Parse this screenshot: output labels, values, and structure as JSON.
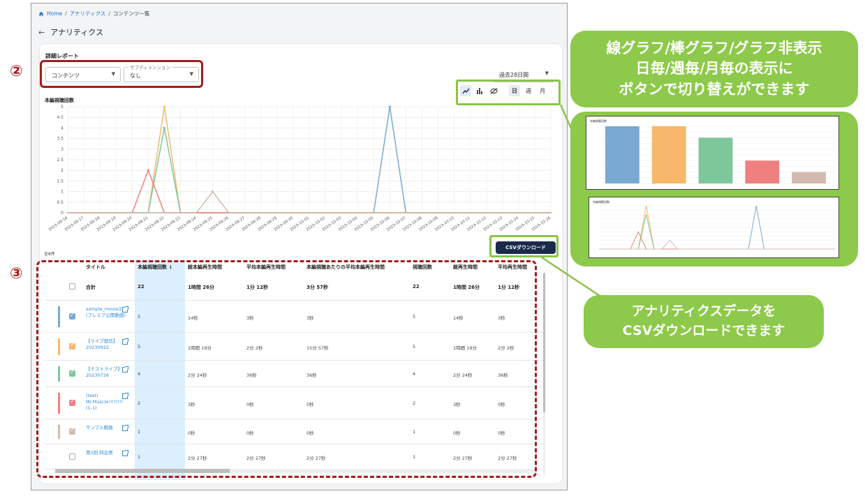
{
  "breadcrumb": {
    "home": "Home",
    "items": [
      "アナリティクス",
      "コンテンツ一覧"
    ]
  },
  "page": {
    "title": "アナリティクス"
  },
  "report": {
    "title": "詳細レポート",
    "dimension_select": "コンテンツ",
    "sub_dimension_label": "サブディメンション",
    "sub_dimension_value": "なし",
    "period_select": "過去28日間"
  },
  "chart_toolbar": {
    "day": "日",
    "week": "週",
    "month": "月",
    "icons": [
      "line-chart-icon",
      "bar-chart-icon",
      "hide-chart-icon"
    ]
  },
  "chart_data": {
    "type": "line",
    "title": "本編視聴回数",
    "ylim": [
      0,
      5
    ],
    "yticks": [
      "0",
      "0.5",
      "1",
      "1.5",
      "2",
      "2.5",
      "3",
      "3.5",
      "4",
      "4.5",
      "5"
    ],
    "x": [
      "2023-09-16",
      "2023-09-17",
      "2023-09-18",
      "2023-09-19",
      "2023-09-20",
      "2023-09-21",
      "2023-09-22",
      "2023-09-23",
      "2023-09-24",
      "2023-09-25",
      "2023-09-26",
      "2023-09-27",
      "2023-09-28",
      "2023-09-29",
      "2023-09-30",
      "2023-10-01",
      "2023-10-02",
      "2023-10-03",
      "2023-10-04",
      "2023-10-05",
      "2023-10-06",
      "2023-10-07",
      "2023-10-08",
      "2023-10-09",
      "2023-10-10",
      "2023-10-11",
      "2023-10-12",
      "2023-10-13",
      "2023-10-14",
      "2023-10-15",
      "2023-10-16"
    ],
    "series": [
      {
        "color": "#7aa9d1",
        "values": [
          0,
          0,
          0,
          0,
          0,
          0,
          0,
          0,
          0,
          0,
          0,
          0,
          0,
          0,
          0,
          0,
          0,
          0,
          0,
          0,
          5,
          0,
          0,
          0,
          0,
          0,
          0,
          0,
          0,
          0,
          0
        ]
      },
      {
        "color": "#f7b86b",
        "values": [
          0,
          0,
          0,
          0,
          0,
          0,
          5,
          0,
          0,
          0,
          0,
          0,
          0,
          0,
          0,
          0,
          0,
          0,
          0,
          0,
          0,
          0,
          0,
          0,
          0,
          0,
          0,
          0,
          0,
          0,
          0
        ]
      },
      {
        "color": "#7dc79a",
        "values": [
          0,
          0,
          0,
          0,
          0,
          0,
          4,
          0,
          0,
          0,
          0,
          0,
          0,
          0,
          0,
          0,
          0,
          0,
          0,
          0,
          0,
          0,
          0,
          0,
          0,
          0,
          0,
          0,
          0,
          0,
          0
        ]
      },
      {
        "color": "#f08080",
        "values": [
          0,
          0,
          0,
          0,
          0,
          2,
          0,
          0,
          0,
          0,
          0,
          0,
          0,
          0,
          0,
          0,
          0,
          0,
          0,
          0,
          0,
          0,
          0,
          0,
          0,
          0,
          0,
          0,
          0,
          0,
          0
        ]
      },
      {
        "color": "#d4b9ae",
        "values": [
          0,
          0,
          0,
          0,
          0,
          0,
          0,
          0,
          0,
          1,
          0,
          0,
          0,
          0,
          0,
          0,
          0,
          0,
          0,
          0,
          0,
          0,
          0,
          0,
          0,
          0,
          0,
          0,
          0,
          0,
          0
        ]
      }
    ],
    "grid": true
  },
  "csv_button": "CSVダウンロード",
  "count_label": "全8件",
  "table": {
    "headers": [
      "タイトル",
      "本編視聴回数 ↓",
      "総本編再生時間",
      "平均本編再生時間",
      "本編視聴あたりの平均本編再生時間",
      "視聴回数",
      "総再生時間",
      "平均再生時間"
    ],
    "total": [
      "合計",
      "22",
      "1時間 26分",
      "1分 12秒",
      "3分 57秒",
      "22",
      "1時間 26分",
      "1分 12秒"
    ],
    "rows": [
      {
        "title": "sample_movie3 (プレミア公開動画)",
        "color": "#7aa9d1",
        "checked": true,
        "cells": [
          "5",
          "14秒",
          "3秒",
          "3秒",
          "5",
          "14秒",
          "3秒"
        ]
      },
      {
        "title": "【ライブ配信】20230922",
        "color": "#f7b86b",
        "checked": true,
        "cells": [
          "5",
          "1時間 19分",
          "2分 2秒",
          "15分 57秒",
          "5",
          "1時間 19分",
          "2分 2秒"
        ]
      },
      {
        "title": "【テストライブ】20230726",
        "color": "#7dc79a",
        "checked": true,
        "cells": [
          "4",
          "2分 24秒",
          "36秒",
          "36秒",
          "4",
          "2分 24秒",
          "36秒"
        ]
      },
      {
        "title": "(test) Mr.Muscle!!!!!!!! (1-1)",
        "color": "#f08080",
        "checked": true,
        "cells": [
          "2",
          "3秒",
          "0秒",
          "0秒",
          "2",
          "3秒",
          "0秒"
        ]
      },
      {
        "title": "サンプル動画",
        "color": "#d4b9ae",
        "checked": true,
        "cells": [
          "1",
          "0秒",
          "0秒",
          "0秒",
          "1",
          "0秒",
          "0秒"
        ]
      },
      {
        "title": "第2回 四古美",
        "color": "",
        "checked": false,
        "cells": [
          "1",
          "2分 27秒",
          "2分 27秒",
          "2分 27秒",
          "1",
          "2分 27秒",
          "2分 27秒"
        ]
      }
    ]
  },
  "annotations": {
    "num2": "②",
    "num3": "③",
    "callout_1": [
      "線グラフ/棒グラフ/グラフ非表示",
      "日毎/週毎/月毎の表示に",
      "ボタンで切り替えができます"
    ],
    "callout_2": [
      "アナリティクスデータを",
      "CSVダウンロードできます"
    ],
    "preview_title": "本編視聴回数"
  },
  "preview_bar": {
    "values": [
      5,
      5,
      4,
      2,
      1
    ],
    "colors": [
      "#7aa9d1",
      "#f7b86b",
      "#7dc79a",
      "#f08080",
      "#d4b9ae"
    ]
  }
}
